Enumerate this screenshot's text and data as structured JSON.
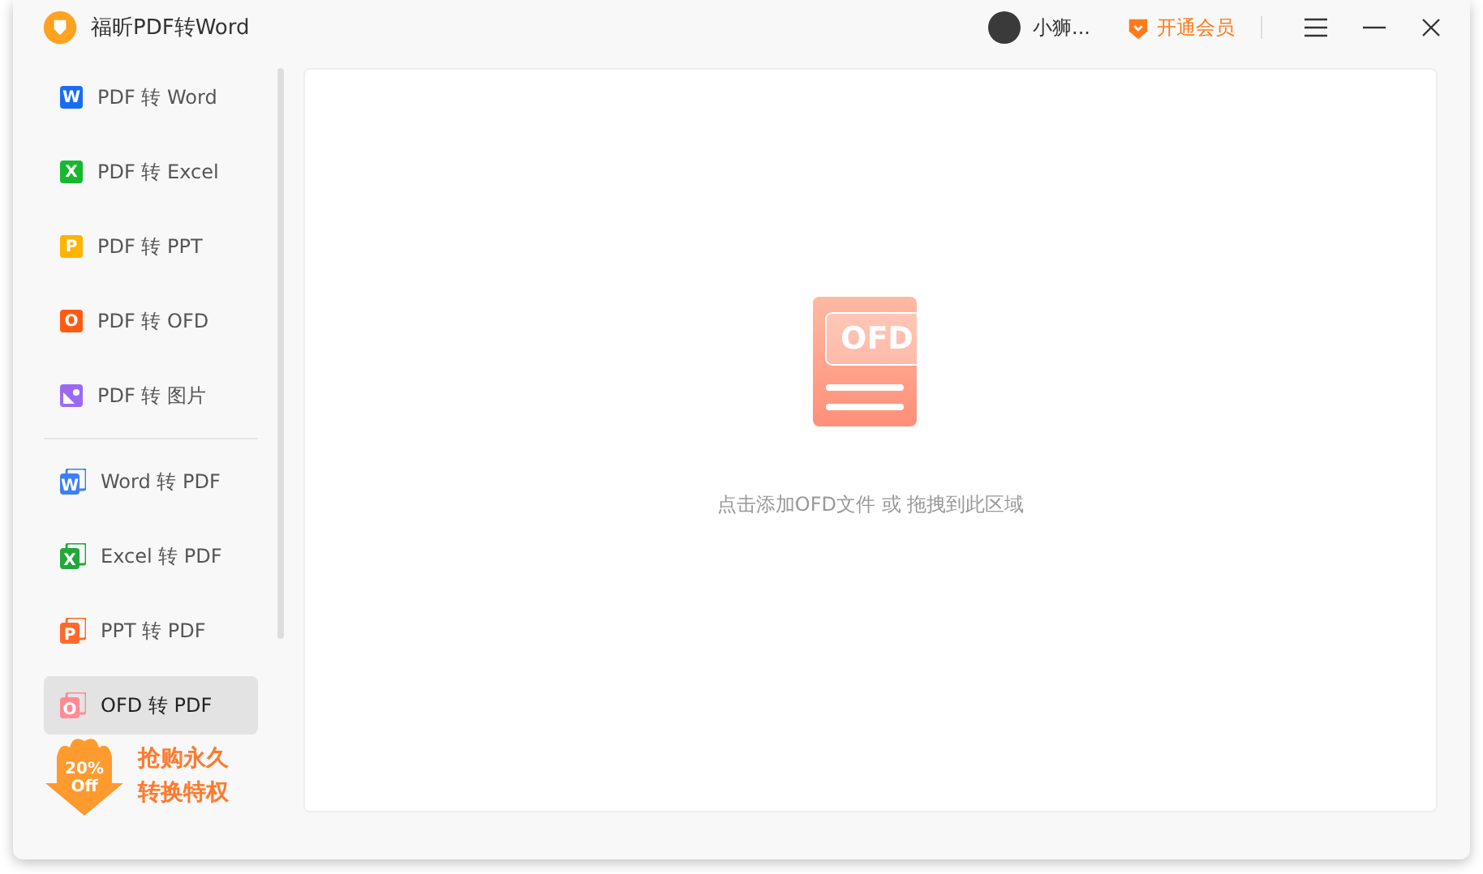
{
  "window": {
    "title": "福昕PDF转Word"
  },
  "header": {
    "user_name": "小狮...",
    "vip_button": "开通会员"
  },
  "sidebar": {
    "sections": [
      {
        "items": [
          {
            "label": "PDF 转 Word",
            "kind": "letter",
            "icon_letter": "W",
            "color": "#1a6cf5",
            "selected": false
          },
          {
            "label": "PDF 转 Excel",
            "kind": "letter",
            "icon_letter": "X",
            "color": "#17b82f",
            "selected": false
          },
          {
            "label": "PDF 转 PPT",
            "kind": "letter",
            "icon_letter": "P",
            "color": "#ffb400",
            "selected": false
          },
          {
            "label": "PDF 转 OFD",
            "kind": "letter",
            "icon_letter": "O",
            "color": "#ff5a12",
            "selected": false
          },
          {
            "label": "PDF 转 图片",
            "kind": "image",
            "color": "#9a6bf2",
            "selected": false
          }
        ]
      },
      {
        "items": [
          {
            "label": "Word 转 PDF",
            "kind": "stacked",
            "icon_letter": "W",
            "color": "#3d7ef7",
            "selected": false
          },
          {
            "label": "Excel 转 PDF",
            "kind": "stacked",
            "icon_letter": "X",
            "color": "#22a83a",
            "selected": false
          },
          {
            "label": "PPT 转 PDF",
            "kind": "stacked",
            "icon_letter": "P",
            "color": "#ff6a2c",
            "selected": false
          },
          {
            "label": "OFD 转 PDF",
            "kind": "stacked",
            "icon_letter": "O",
            "color": "#ff8a95",
            "selected": true
          }
        ]
      }
    ]
  },
  "promo": {
    "badge_percent": "20%",
    "badge_off": "Off",
    "lines": [
      "抢购永久",
      "转换特权"
    ]
  },
  "drop_zone": {
    "file_label": "OFD",
    "hint": "点击添加OFD文件 或 拖拽到此区域"
  }
}
